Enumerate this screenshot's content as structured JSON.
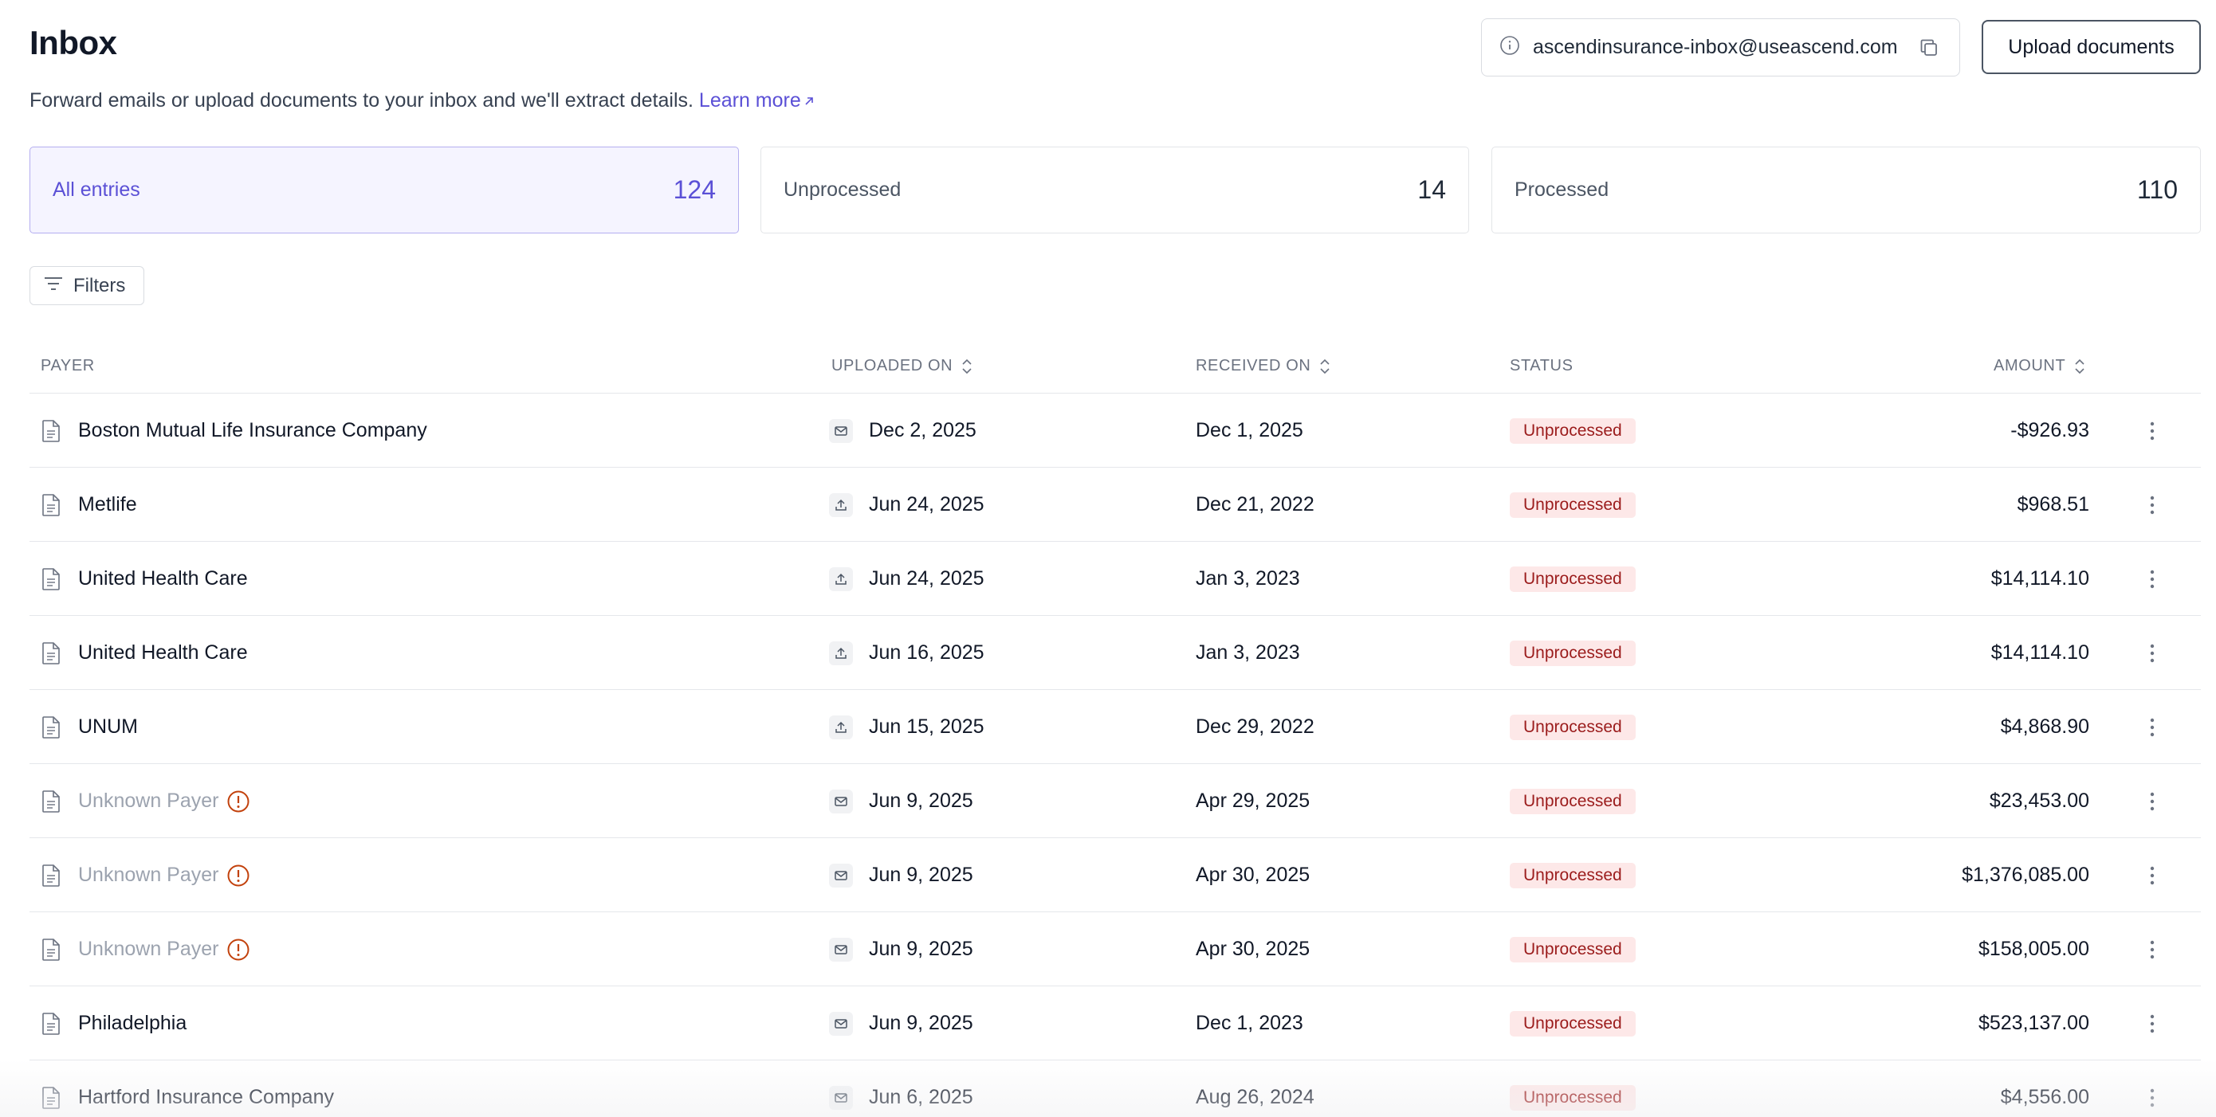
{
  "header": {
    "title": "Inbox",
    "subtitle": "Forward emails or upload documents to your inbox and we'll extract details.",
    "learn_more": "Learn more",
    "email": "ascendinsurance-inbox@useascend.com",
    "upload_label": "Upload documents"
  },
  "cards": [
    {
      "label": "All entries",
      "count": "124",
      "active": true
    },
    {
      "label": "Unprocessed",
      "count": "14",
      "active": false
    },
    {
      "label": "Processed",
      "count": "110",
      "active": false
    }
  ],
  "filters_label": "Filters",
  "table": {
    "columns": {
      "payer": "PAYER",
      "uploaded_on": "UPLOADED ON",
      "received_on": "RECEIVED ON",
      "status": "STATUS",
      "amount": "AMOUNT"
    },
    "rows": [
      {
        "payer": "Boston Mutual Life Insurance Company",
        "unknown": false,
        "source": "email",
        "uploaded": "Dec 2, 2025",
        "received": "Dec 1, 2025",
        "status": "Unprocessed",
        "amount": "-$926.93"
      },
      {
        "payer": "Metlife",
        "unknown": false,
        "source": "upload",
        "uploaded": "Jun 24, 2025",
        "received": "Dec 21, 2022",
        "status": "Unprocessed",
        "amount": "$968.51"
      },
      {
        "payer": "United Health Care",
        "unknown": false,
        "source": "upload",
        "uploaded": "Jun 24, 2025",
        "received": "Jan 3, 2023",
        "status": "Unprocessed",
        "amount": "$14,114.10"
      },
      {
        "payer": "United Health Care",
        "unknown": false,
        "source": "upload",
        "uploaded": "Jun 16, 2025",
        "received": "Jan 3, 2023",
        "status": "Unprocessed",
        "amount": "$14,114.10"
      },
      {
        "payer": "UNUM",
        "unknown": false,
        "source": "upload",
        "uploaded": "Jun 15, 2025",
        "received": "Dec 29, 2022",
        "status": "Unprocessed",
        "amount": "$4,868.90"
      },
      {
        "payer": "Unknown Payer",
        "unknown": true,
        "source": "email",
        "uploaded": "Jun 9, 2025",
        "received": "Apr 29, 2025",
        "status": "Unprocessed",
        "amount": "$23,453.00"
      },
      {
        "payer": "Unknown Payer",
        "unknown": true,
        "source": "email",
        "uploaded": "Jun 9, 2025",
        "received": "Apr 30, 2025",
        "status": "Unprocessed",
        "amount": "$1,376,085.00"
      },
      {
        "payer": "Unknown Payer",
        "unknown": true,
        "source": "email",
        "uploaded": "Jun 9, 2025",
        "received": "Apr 30, 2025",
        "status": "Unprocessed",
        "amount": "$158,005.00"
      },
      {
        "payer": "Philadelphia",
        "unknown": false,
        "source": "email",
        "uploaded": "Jun 9, 2025",
        "received": "Dec 1, 2023",
        "status": "Unprocessed",
        "amount": "$523,137.00"
      },
      {
        "payer": "Hartford Insurance Company",
        "unknown": false,
        "source": "email",
        "uploaded": "Jun 6, 2025",
        "received": "Aug 26, 2024",
        "status": "Unprocessed",
        "amount": "$4,556.00"
      }
    ]
  },
  "icons": {
    "document": "file-text-icon",
    "email_source": "mail-icon",
    "upload_source": "upload-icon",
    "warning": "alert-circle-icon",
    "row_menu": "more-vertical-icon",
    "sort": "chevrons-up-down-icon",
    "copy": "copy-icon",
    "info": "info-icon",
    "filter": "filter-lines-icon",
    "external": "arrow-up-right-icon"
  },
  "colors": {
    "accent": "#5b50d6",
    "accent_bg": "#f5f4ff",
    "status_bg": "#fde8e8",
    "status_text": "#9b1c1c",
    "warning": "#c2410c",
    "muted": "#9ca3af"
  }
}
